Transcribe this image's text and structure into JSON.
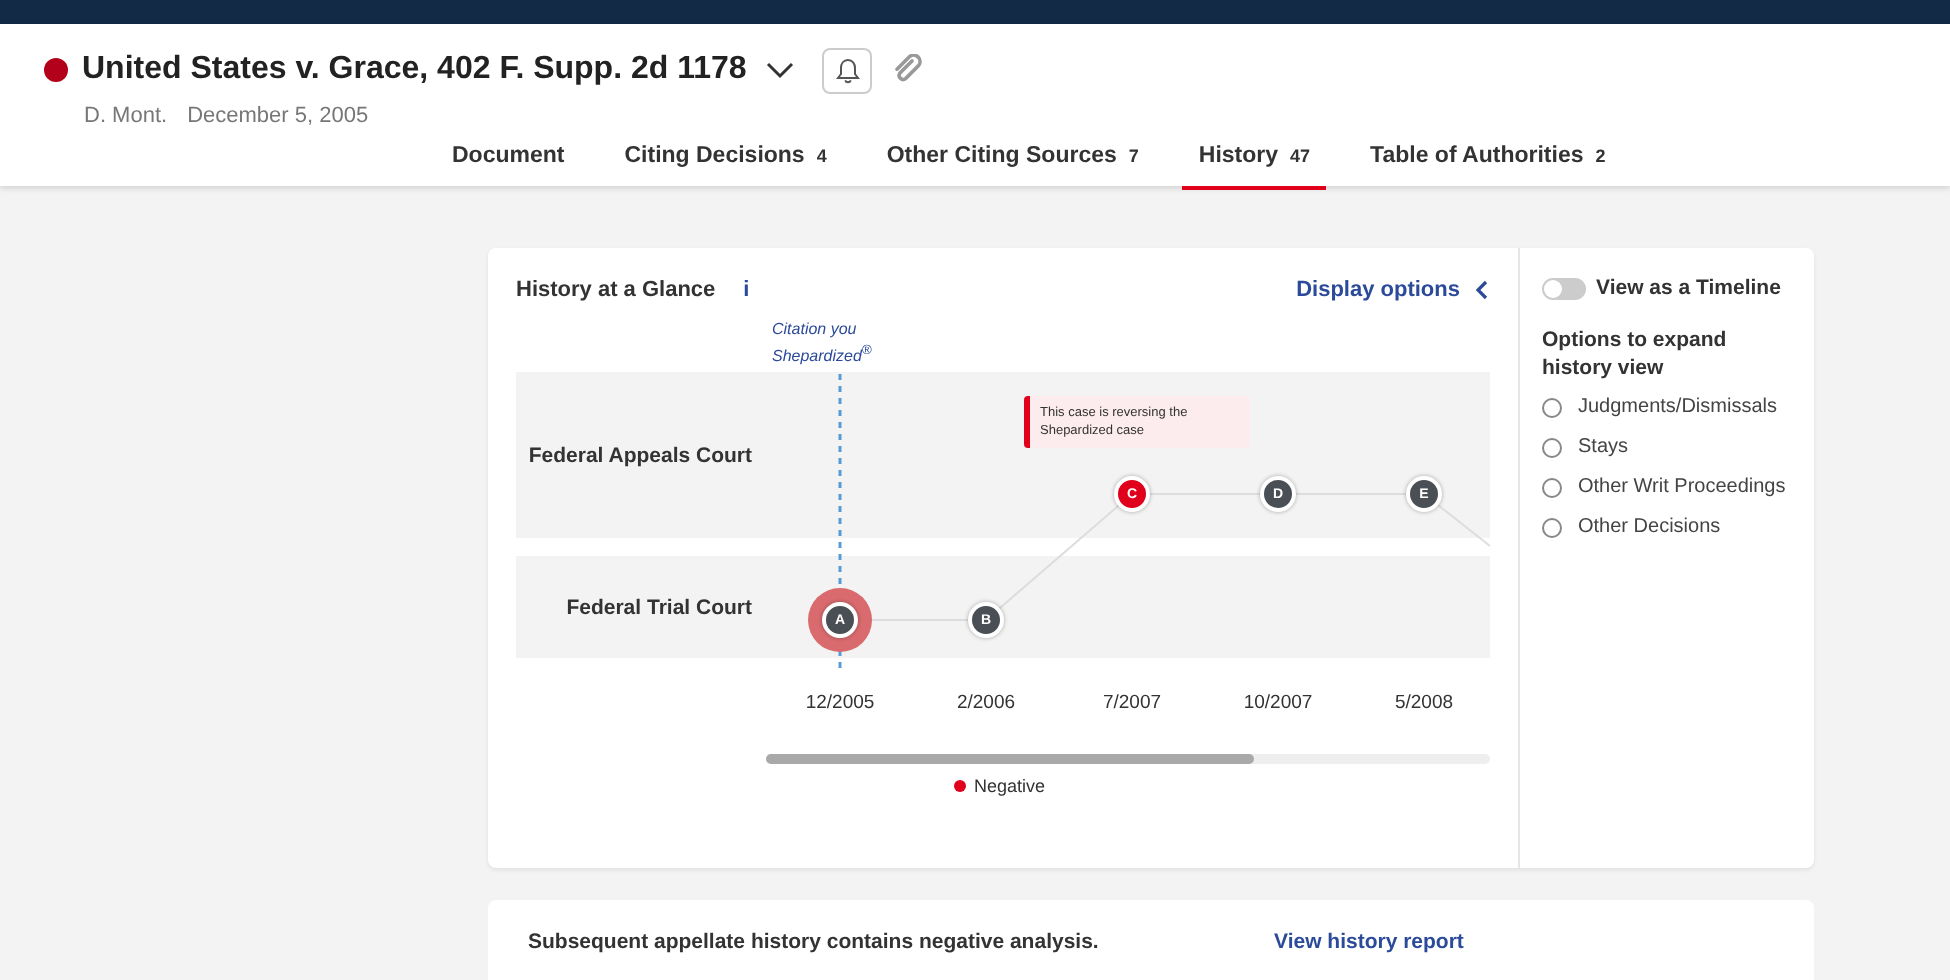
{
  "header": {
    "negative": true,
    "title": "United States v. Grace, 402 F. Supp. 2d 1178",
    "court": "D. Mont.",
    "date": "December 5, 2005"
  },
  "tabs": [
    {
      "label": "Document",
      "selected": false
    },
    {
      "label": "Citing Decisions",
      "count": "4",
      "selected": false
    },
    {
      "label": "Other Citing Sources",
      "count": "7",
      "selected": false
    },
    {
      "label": "History",
      "count": "47",
      "selected": true
    },
    {
      "label": "Table of Authorities",
      "count": "2",
      "selected": false
    }
  ],
  "glance": {
    "title": "History at a Glance",
    "info": "i",
    "display_options": "Display options",
    "citation_label": "Citation you Shepardized$^{®}$",
    "courts": [
      {
        "kind": "appeals",
        "name": "Federal Appeals Court"
      },
      {
        "kind": "trial",
        "name": "Federal Trial Court"
      }
    ],
    "columns": [
      {
        "date": "12/2005",
        "node": {
          "letter": "A",
          "kind": "trial",
          "negative": false,
          "shepardized": true
        }
      },
      {
        "date": "2/2006",
        "node": {
          "letter": "B",
          "kind": "trial",
          "negative": false,
          "shepardized": false
        }
      },
      {
        "date": "7/2007",
        "node": {
          "letter": "C",
          "kind": "appeals",
          "negative": true,
          "shepardized": false,
          "tooltip": "This case is reversing the Shepardized case"
        }
      },
      {
        "date": "10/2007",
        "node": {
          "letter": "D",
          "kind": "appeals",
          "negative": false,
          "shepardized": false
        }
      },
      {
        "date": "5/2008",
        "node": {
          "letter": "E",
          "kind": "appeals",
          "negative": false,
          "shepardized": false
        }
      }
    ],
    "legend": [
      {
        "label": "Negative",
        "color": "#e0001b"
      }
    ]
  },
  "sidebar": {
    "toggle": {
      "label": "View as a Timeline",
      "on": false
    },
    "options_title": "Options to expand history view",
    "options": [
      {
        "label": "Judgments/Dismissals",
        "checked": false
      },
      {
        "label": "Stays",
        "checked": false
      },
      {
        "label": "Other Writ Proceedings",
        "checked": false
      },
      {
        "label": "Other Decisions",
        "checked": false
      }
    ]
  },
  "summary": {
    "text": "Subsequent appellate history contains negative analysis.",
    "link": "View history report"
  }
}
